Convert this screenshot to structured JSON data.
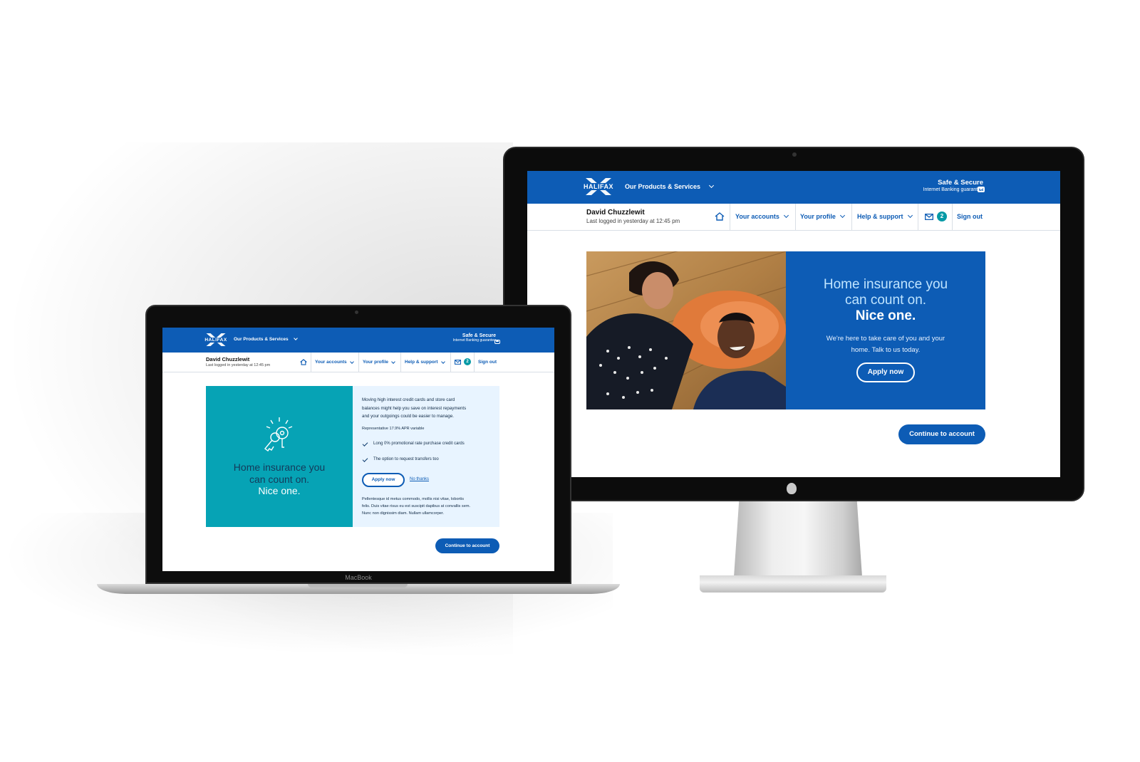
{
  "brand": {
    "name": "HALIFAX",
    "color": "#0d5cb5"
  },
  "header": {
    "products_label": "Our Products & Services",
    "secure_title": "Safe & Secure",
    "secure_sub": "Internet Banking guarantee"
  },
  "user": {
    "name": "David Chuzzlewit",
    "last_login": "Last logged in yesterday at 12:45 pm"
  },
  "nav": {
    "home": "home-icon",
    "accounts": "Your accounts",
    "profile": "Your profile",
    "help": "Help & support",
    "messages_count": "2",
    "sign_out": "Sign out"
  },
  "imac_promo": {
    "headline_1": "Home insurance you",
    "headline_2": "can count on.",
    "headline_3": "Nice one.",
    "body_1": "We're here to take care of you and your",
    "body_2": "home. Talk to us today.",
    "apply": "Apply now",
    "continue": "Continue to account"
  },
  "mac_promo": {
    "headline_1": "Home insurance you",
    "headline_2": "can count on.",
    "headline_3": "Nice one.",
    "intro_1": "Moving high interest credit cards and store card",
    "intro_2": "balances might help you save on interest repayments",
    "intro_3": "and your outgoings could be easier to manage.",
    "apr": "Representative 17.9% APR variable",
    "bullets": [
      "Long 0% promotional rate purchase credit cards",
      "The option to request transfers too"
    ],
    "apply": "Apply now",
    "no_thanks": "No thanks",
    "lorem_1": "Pellentesque id metus commodo, mollis nisi vitae, lobortis",
    "lorem_2": "felis. Duis vitae risus eu est suscipit dapibus at convallis sem.",
    "lorem_3": "Nunc non dignissim diam. Nullam ullamcorper.",
    "continue": "Continue to account"
  },
  "device_label": "MacBook",
  "colors": {
    "teal": "#06a3b5",
    "light_blue": "#e8f4ff",
    "badge": "#069aa6"
  }
}
